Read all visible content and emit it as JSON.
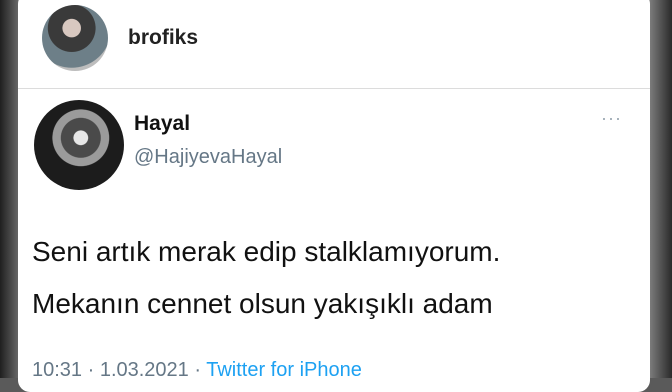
{
  "post": {
    "username": "brofiks"
  },
  "tweet": {
    "name": "Hayal",
    "handle": "@HajiyevaHayal",
    "more_label": "···",
    "text_line1": "Seni artık merak edip stalklamıyorum.",
    "text_line2": "Mekanın cennet olsun yakışıklı adam",
    "timestamp": "10:31 · 1.03.2021 ·",
    "source": "Twitter for iPhone"
  }
}
